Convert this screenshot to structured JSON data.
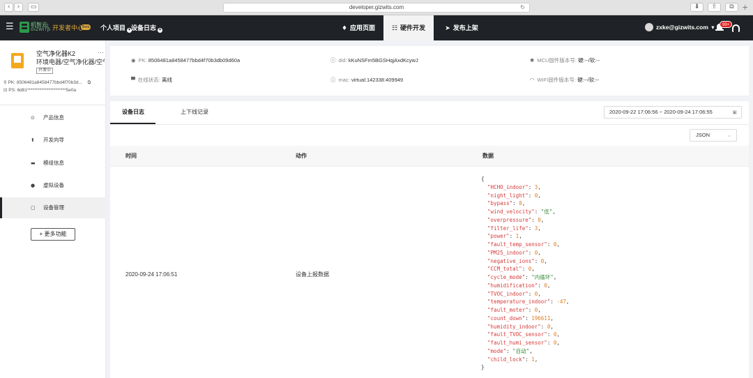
{
  "browser": {
    "url": "developer.gizwits.com",
    "back_glyph": "‹",
    "forward_glyph": "›",
    "reload_glyph": "↻"
  },
  "topbar": {
    "brand_cn": "机智云",
    "brand_en": "GIZWITS",
    "dev_center": "开发者中心",
    "beta": "Beta",
    "personal_project": "个人项目",
    "device_log": "设备日志",
    "tabs": [
      {
        "label": "应用页面",
        "icon": "diamond-icon",
        "glyph": "♦"
      },
      {
        "label": "硬件开发",
        "icon": "sliders-icon",
        "glyph": "☷"
      },
      {
        "label": "发布上架",
        "icon": "send-icon",
        "glyph": "➤"
      }
    ],
    "active_tab": "硬件开发",
    "user_email": "zxke@gizwits.com",
    "user_caret": "▾",
    "notification_count": "99+"
  },
  "device": {
    "name": "空气净化器K2",
    "category": "环境电器/空气净化器/空气净化器",
    "status_tag": "开发中",
    "pk_label": "PK:",
    "pk_value": "8506481a8458477bbd4f70b3d...",
    "ps_label": "PS:",
    "ps_value": "6d81**********************5e0a",
    "more": "···"
  },
  "sidebar": {
    "items": [
      {
        "label": "产品信息",
        "icon": "info-circle-icon",
        "glyph": "⊙"
      },
      {
        "label": "开发向导",
        "icon": "signpost-icon",
        "glyph": "⬆"
      },
      {
        "label": "模组信息",
        "icon": "module-icon",
        "glyph": "▬"
      },
      {
        "label": "虚拟设备",
        "icon": "virtual-device-icon",
        "glyph": "●"
      },
      {
        "label": "设备管理",
        "icon": "device-manage-icon",
        "glyph": "▢"
      }
    ],
    "active": "设备管理",
    "more_button": "+ 更多功能"
  },
  "info": {
    "pk_label": "PK:",
    "pk_value": "8506481a8458477bbd4f70b3db09d60a",
    "did_label": "did:",
    "did_value": "kKuNSFm5BGSHqjAxdKcywJ",
    "mcu_label": "MCU固件版本号:",
    "mcu_value": "硬:--/软:--",
    "online_label": "在线状态:",
    "online_value": "离线",
    "mac_label": "mac:",
    "mac_value": "virtual:142338:409949",
    "wifi_label": "WIFI固件版本号:",
    "wifi_value": "硬:--/软:--"
  },
  "log": {
    "tabs": [
      "设备日志",
      "上下线记录"
    ],
    "active_tab": "设备日志",
    "date_range": "2020-09-22 17:06:56 ~ 2020-09-24 17:06:55",
    "format_select": "JSON",
    "columns": [
      "时间",
      "动作",
      "数据"
    ],
    "rows": [
      {
        "time": "2020-09-24 17:06:51",
        "action": "设备上报数据",
        "data": [
          {
            "key": "HCHO_indoor",
            "value": "3",
            "type": "num"
          },
          {
            "key": "night_light",
            "value": "0",
            "type": "num"
          },
          {
            "key": "bypass",
            "value": "0",
            "type": "num"
          },
          {
            "key": "wind_velocity",
            "value": "\"低\"",
            "type": "str"
          },
          {
            "key": "overpressure",
            "value": "0",
            "type": "num"
          },
          {
            "key": "filter_life",
            "value": "3",
            "type": "num"
          },
          {
            "key": "power",
            "value": "1",
            "type": "num"
          },
          {
            "key": "fault_temp_sensor",
            "value": "0",
            "type": "num"
          },
          {
            "key": "PM25_indoor",
            "value": "0",
            "type": "num"
          },
          {
            "key": "negative_ions",
            "value": "0",
            "type": "num"
          },
          {
            "key": "CCM_total",
            "value": "0",
            "type": "num"
          },
          {
            "key": "cycle_mode",
            "value": "\"内循环\"",
            "type": "str"
          },
          {
            "key": "humidification",
            "value": "0",
            "type": "num"
          },
          {
            "key": "TVOC_indoor",
            "value": "0",
            "type": "num"
          },
          {
            "key": "temperature_indoor",
            "value": "-47",
            "type": "num"
          },
          {
            "key": "fault_moter",
            "value": "0",
            "type": "num"
          },
          {
            "key": "count_down",
            "value": "196611",
            "type": "num"
          },
          {
            "key": "humidity_indoor",
            "value": "0",
            "type": "num"
          },
          {
            "key": "fault_TVOC_sensor",
            "value": "0",
            "type": "num"
          },
          {
            "key": "fault_humi_sensor",
            "value": "0",
            "type": "num"
          },
          {
            "key": "mode",
            "value": "\"自动\"",
            "type": "str"
          },
          {
            "key": "child_lock",
            "value": "1",
            "type": "num"
          }
        ]
      }
    ]
  },
  "colors": {
    "nav_bg": "#1f2226",
    "brand_green": "#2b9a4a",
    "dev_center_gold": "#e0a93b",
    "json_key": "#d63a3a",
    "json_number": "#e07b1f",
    "json_string": "#3a8a3a",
    "badge_red": "#e02020"
  }
}
